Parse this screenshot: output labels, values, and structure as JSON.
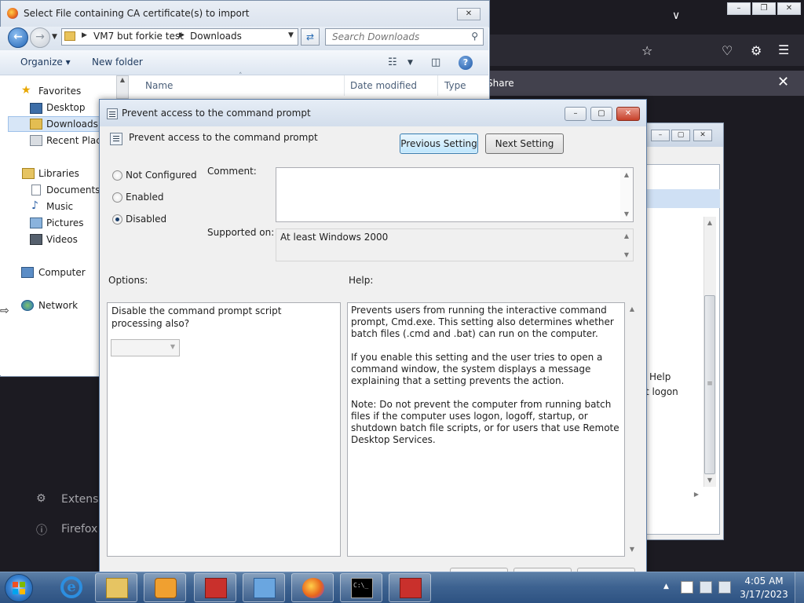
{
  "firefox": {
    "notification_share": "Share",
    "side_items": [
      "Extensio",
      "Firefox S"
    ]
  },
  "explorer": {
    "title": "Select File containing CA certificate(s) to import",
    "breadcrumb": [
      "VM7 but forkie test",
      "Downloads"
    ],
    "search_placeholder": "Search Downloads",
    "organize_label": "Organize",
    "new_folder_label": "New folder",
    "nav": {
      "favorites": "Favorites",
      "desktop": "Desktop",
      "downloads": "Downloads",
      "recent_places": "Recent Place",
      "libraries": "Libraries",
      "documents": "Documents",
      "music": "Music",
      "pictures": "Pictures",
      "videos": "Videos",
      "computer": "Computer",
      "network": "Network"
    },
    "columns": [
      "Name",
      "Date modified",
      "Type"
    ]
  },
  "gpe": {
    "help_text": "Help",
    "logon_text": "t logon"
  },
  "dialog": {
    "title": "Prevent access to the command prompt",
    "setting_name": "Prevent access to the command prompt",
    "previous_button": "Previous Setting",
    "next_button": "Next Setting",
    "state_options": [
      "Not Configured",
      "Enabled",
      "Disabled"
    ],
    "selected_state": "Disabled",
    "comment_label": "Comment:",
    "comment_value": "",
    "supported_label": "Supported on:",
    "supported_value": "At least Windows 2000",
    "options_label": "Options:",
    "help_label": "Help:",
    "option_text": "Disable the command prompt script processing also?",
    "option_value": "",
    "help_paragraphs": [
      "Prevents users from running the interactive command prompt, Cmd.exe. This setting also determines whether batch files (.cmd and .bat) can run on the computer.",
      "If you enable this setting and the user tries to open a command window, the system displays a message explaining that a setting prevents the action.",
      "Note: Do not prevent the computer from running batch files if the computer uses logon, logoff, startup, or shutdown batch file scripts, or for users that use Remote Desktop Services."
    ]
  },
  "taskbar": {
    "time": "4:05 AM",
    "date": "3/17/2023",
    "apps": [
      "internet-explorer",
      "windows-explorer",
      "media-player",
      "toolbox",
      "control-panel",
      "firefox",
      "command-prompt",
      "toolbox-2"
    ]
  }
}
